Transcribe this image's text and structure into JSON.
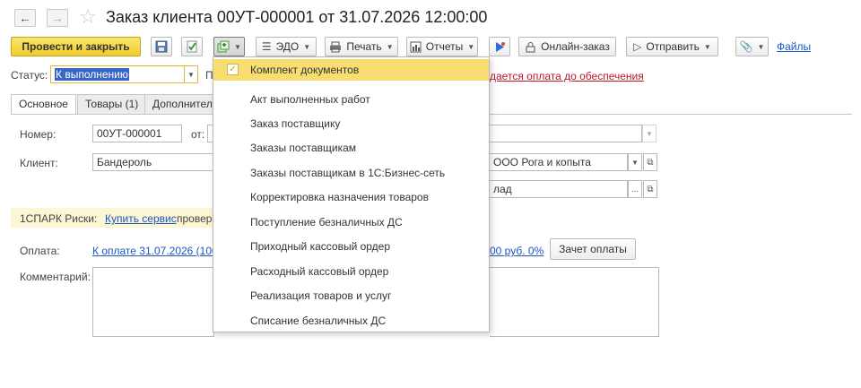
{
  "window": {
    "title": "Заказ клиента 00УТ-000001 от 31.07.2026 12:00:00"
  },
  "toolbar": {
    "post_close": "Провести и закрыть",
    "edo": "ЭДО",
    "print": "Печать",
    "reports": "Отчеты",
    "online_order": "Онлайн-заказ",
    "send": "Отправить",
    "files": "Файлы"
  },
  "status": {
    "label": "Статус:",
    "value": "К выполнению",
    "next_label_start": "П",
    "warning": "дается оплата до обеспечения"
  },
  "tabs": [
    {
      "label": "Основное"
    },
    {
      "label": "Товары (1)"
    },
    {
      "label": "Дополнитель"
    }
  ],
  "form": {
    "number_label": "Номер:",
    "number_value": "00УТ-000001",
    "date_label": "от:",
    "client_label": "Клиент:",
    "client_value": "Бандероль",
    "organization_value": "ООО Рога и копыта",
    "warehouse_value": "лад",
    "spark_label": "1СПАРК Риски:",
    "spark_link": "Купить сервис",
    "spark_tail": "провер",
    "payment_label": "Оплата:",
    "payment_link": "К оплате 31.07.2026 (100",
    "payment_link_tail": "00 руб. 0%",
    "offset_button": "Зачет оплаты",
    "comment_label": "Комментарий:"
  },
  "menu": {
    "items": [
      {
        "label": "Комплект документов",
        "checked": true
      },
      {
        "label": "Акт выполненных работ"
      },
      {
        "label": "Заказ поставщику"
      },
      {
        "label": "Заказы поставщикам"
      },
      {
        "label": "Заказы поставщикам в 1С:Бизнес-сеть"
      },
      {
        "label": "Корректировка назначения товаров"
      },
      {
        "label": "Поступление безналичных ДС"
      },
      {
        "label": "Приходный кассовый ордер"
      },
      {
        "label": "Расходный кассовый ордер"
      },
      {
        "label": "Реализация товаров и услуг"
      },
      {
        "label": "Списание безналичных ДС"
      }
    ]
  },
  "colors": {
    "primary_button": "#f1cd2c",
    "menu_highlight": "#f7dd72",
    "link": "#1a56c4",
    "warning": "#c0142a"
  }
}
